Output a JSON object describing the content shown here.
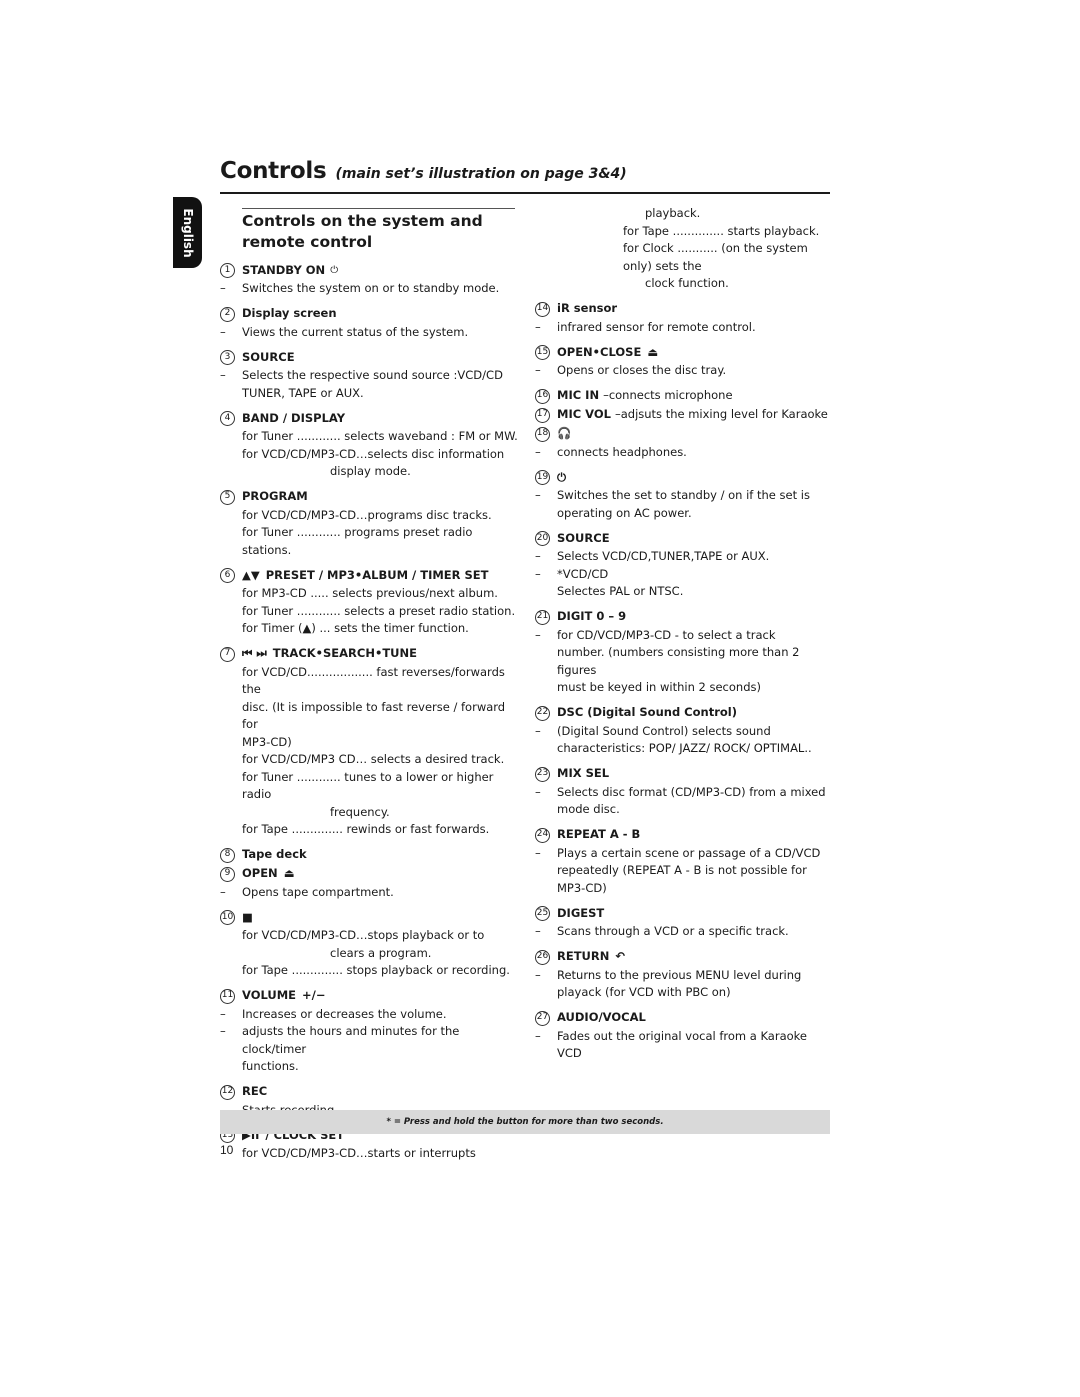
{
  "page": {
    "title_main": "Controls",
    "title_sub": "(main set’s illustration on page 3&4)",
    "language_tab": "English",
    "section_title": "Controls on the system and remote control",
    "footnote": "* = Press and hold the button for more than two seconds.",
    "page_number": "10"
  },
  "left": [
    {
      "num": "1",
      "label": "STANDBY ON",
      "icon": "power-icon",
      "lines": [
        {
          "t": "Switches the system on or to standby mode.",
          "dash": true
        }
      ]
    },
    {
      "num": "2",
      "label": "Display screen",
      "lines": [
        {
          "t": "Views the current status of the system.",
          "dash": true
        }
      ]
    },
    {
      "num": "3",
      "label": "SOURCE",
      "lines": [
        {
          "t": "Selects the respective sound source :VCD/CD",
          "dash": true
        },
        {
          "t": "TUNER, TAPE or AUX."
        }
      ]
    },
    {
      "num": "4",
      "label": "BAND / DISPLAY",
      "lines": [
        {
          "t": "for Tuner ............ selects waveband : FM or MW."
        },
        {
          "t": "for VCD/CD/MP3-CD…selects disc information"
        },
        {
          "t": "display mode.",
          "indent": "indent2"
        }
      ]
    },
    {
      "num": "5",
      "label": "PROGRAM",
      "lines": [
        {
          "t": "for  VCD/CD/MP3-CD…programs disc tracks."
        },
        {
          "t": "for Tuner ............ programs preset radio stations."
        }
      ]
    },
    {
      "num": "6",
      "prefix": "▲▼",
      "label": "PRESET / MP3•ALBUM / TIMER SET",
      "lines": [
        {
          "t": "for MP3-CD ..... selects previous/next album."
        },
        {
          "t": "for Tuner ............ selects a preset radio station."
        },
        {
          "t": "for Timer (▲) ... sets the timer function."
        }
      ]
    },
    {
      "num": "7",
      "prefix": "⏮ ⏭",
      "label": "TRACK•SEARCH•TUNE",
      "lines": [
        {
          "t": "for VCD/CD.................. fast reverses/forwards the"
        },
        {
          "t": "disc. (It is impossible to fast reverse / forward for"
        },
        {
          "t": "MP3-CD)"
        },
        {
          "t": "for VCD/CD/MP3 CD… selects a desired track."
        },
        {
          "t": "for Tuner ............  tunes to a lower or higher radio"
        },
        {
          "t": "frequency.",
          "indent": "indent2"
        },
        {
          "t": "for Tape ..............  rewinds or fast forwards."
        }
      ]
    },
    {
      "num": "8",
      "label": "Tape deck",
      "lines": []
    },
    {
      "num": "9",
      "label": "OPEN",
      "suffix": "⏏",
      "lines": [
        {
          "t": "Opens tape compartment.",
          "dash": true
        }
      ]
    },
    {
      "num": "10",
      "label": "■",
      "lines": [
        {
          "t": "for VCD/CD/MP3-CD…stops playback or to"
        },
        {
          "t": "clears a program.",
          "indent": "indent2"
        },
        {
          "t": "for Tape .............. stops playback or recording."
        }
      ]
    },
    {
      "num": "11",
      "label": "VOLUME",
      "suffix": "+/−",
      "lines": [
        {
          "t": "Increases or decreases the volume.",
          "dash": true
        },
        {
          "t": "adjusts the hours and minutes for the clock/timer",
          "dash": true
        },
        {
          "t": "functions."
        }
      ]
    },
    {
      "num": "12",
      "label": "REC",
      "lines": [
        {
          "t": "Starts recording.",
          "dash": true
        }
      ]
    },
    {
      "num": "13",
      "prefix": "▶II",
      "label": "/ CLOCK SET",
      "lines": [
        {
          "t": "for VCD/CD/MP3-CD…starts or interrupts"
        }
      ]
    }
  ],
  "right_continuation": [
    {
      "t": "playback.",
      "indent": "indent2"
    },
    {
      "t": "for Tape .............. starts playback."
    },
    {
      "t": "for Clock ........... (on the system only) sets the"
    },
    {
      "t": "clock function.",
      "indent": "indent2"
    }
  ],
  "right": [
    {
      "num": "14",
      "label": "iR sensor",
      "lines": [
        {
          "t": "infrared sensor for remote control.",
          "dash": true
        }
      ]
    },
    {
      "num": "15",
      "label": "OPEN•CLOSE",
      "suffix": "⏏",
      "lines": [
        {
          "t": "Opens or closes the disc tray.",
          "dash": true
        }
      ]
    },
    {
      "num": "16",
      "label": "MIC IN",
      "inline": "–connects microphone",
      "lines": []
    },
    {
      "num": "17",
      "label": "MIC VOL",
      "inline": "–adjsuts the mixing level for Karaoke",
      "lines": []
    },
    {
      "num": "18",
      "label": "🎧",
      "icon": "headphones-icon",
      "lines": [
        {
          "t": "connects headphones.",
          "dash": true
        }
      ]
    },
    {
      "num": "19",
      "label": "⏻",
      "icon": "power-icon",
      "lines": [
        {
          "t": "Switches the set to standby / on if the set is",
          "dash": true
        },
        {
          "t": "operating on AC power."
        }
      ]
    },
    {
      "num": "20",
      "label": "SOURCE",
      "lines": [
        {
          "t": "Selects VCD/CD,TUNER,TAPE or AUX.",
          "dash": true
        },
        {
          "t": "*VCD/CD",
          "dash": true
        },
        {
          "t": "Selectes PAL or NTSC."
        }
      ]
    },
    {
      "num": "21",
      "label": "DIGIT 0 – 9",
      "lines": [
        {
          "t": "for CD/VCD/MP3-CD - to select a track",
          "dash": true
        },
        {
          "t": "number. (numbers consisting more than 2 figures"
        },
        {
          "t": "must be keyed in within 2 seconds)"
        }
      ]
    },
    {
      "num": "22",
      "label": "DSC (Digital Sound Control)",
      "lines": [
        {
          "t": "(Digital Sound Control) selects sound",
          "dash": true
        },
        {
          "t": "characteristics: POP/ JAZZ/ ROCK/ OPTIMAL.."
        }
      ]
    },
    {
      "num": "23",
      "label": "MIX SEL",
      "lines": [
        {
          "t": "Selects disc format (CD/MP3-CD) from a mixed",
          "dash": true
        },
        {
          "t": "mode disc."
        }
      ]
    },
    {
      "num": "24",
      "label": "REPEAT A - B",
      "lines": [
        {
          "t": "Plays a certain scene or passage of a CD/VCD",
          "dash": true
        },
        {
          "t": "repeatedly  (REPEAT A - B is not possible for"
        },
        {
          "t": "MP3-CD)"
        }
      ]
    },
    {
      "num": "25",
      "label": "DIGEST",
      "lines": [
        {
          "t": "Scans through a VCD or a specific track.",
          "dash": true
        }
      ]
    },
    {
      "num": "26",
      "label": "RETURN",
      "suffix": "↶",
      "lines": [
        {
          "t": "Returns to the previous MENU level during",
          "dash": true
        },
        {
          "t": "playack (for VCD with PBC on)"
        }
      ]
    },
    {
      "num": "27",
      "label": "AUDIO/VOCAL",
      "lines": [
        {
          "t": "Fades out the original vocal from a Karaoke VCD",
          "dash": true
        }
      ]
    }
  ]
}
